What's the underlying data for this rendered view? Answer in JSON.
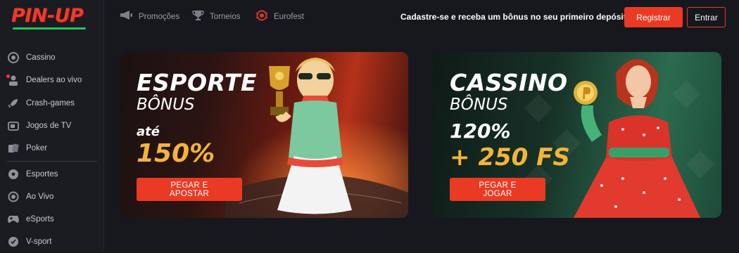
{
  "brand": {
    "logo_text": "PIN-UP"
  },
  "sidebar": {
    "items": [
      {
        "label": "Cassino",
        "icon": "casino-chip-icon"
      },
      {
        "label": "Dealers ao vivo",
        "icon": "dealer-icon"
      },
      {
        "label": "Crash-games",
        "icon": "rocket-icon"
      },
      {
        "label": "Jogos de TV",
        "icon": "tv-icon"
      },
      {
        "label": "Poker",
        "icon": "cards-icon"
      },
      {
        "label": "Esportes",
        "icon": "soccer-ball-icon"
      },
      {
        "label": "Ao Vivo",
        "icon": "live-icon"
      },
      {
        "label": "eSports",
        "icon": "gamepad-icon"
      },
      {
        "label": "V-sport",
        "icon": "virtual-sport-icon"
      }
    ]
  },
  "topbar": {
    "nav": [
      {
        "label": "Promoções",
        "icon": "megaphone-icon"
      },
      {
        "label": "Torneios",
        "icon": "trophy-icon"
      },
      {
        "label": "Eurofest",
        "icon": "eurofest-icon"
      }
    ],
    "promo_text": "Cadastre-se e receba um bônus no seu primeiro depósito",
    "register_label": "Registrar",
    "login_label": "Entrar"
  },
  "banners": [
    {
      "title": "ESPORTE",
      "subtitle": "BÔNUS",
      "prefix": "até",
      "amount": "150%",
      "cta": "PEGAR E APOSTAR"
    },
    {
      "title": "CASSINO",
      "subtitle": "BÔNUS",
      "amount": "120%",
      "extra": "+ 250 FS",
      "cta": "PEGAR E JOGAR"
    }
  ],
  "colors": {
    "accent": "#ea3a23",
    "gold": "#f3b43a",
    "logo_underline": "#22c55e"
  }
}
